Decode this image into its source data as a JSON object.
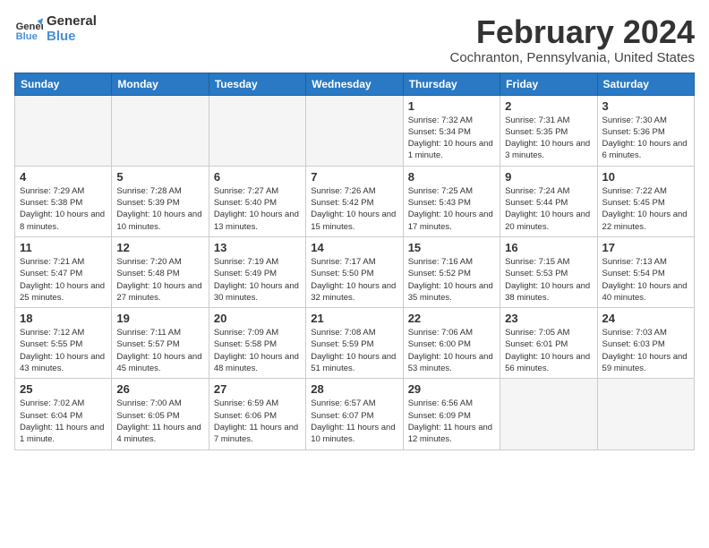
{
  "logo": {
    "text_general": "General",
    "text_blue": "Blue"
  },
  "title": "February 2024",
  "location": "Cochranton, Pennsylvania, United States",
  "weekdays": [
    "Sunday",
    "Monday",
    "Tuesday",
    "Wednesday",
    "Thursday",
    "Friday",
    "Saturday"
  ],
  "weeks": [
    [
      {
        "day": "",
        "info": "",
        "empty": true
      },
      {
        "day": "",
        "info": "",
        "empty": true
      },
      {
        "day": "",
        "info": "",
        "empty": true
      },
      {
        "day": "",
        "info": "",
        "empty": true
      },
      {
        "day": "1",
        "info": "Sunrise: 7:32 AM\nSunset: 5:34 PM\nDaylight: 10 hours and 1 minute."
      },
      {
        "day": "2",
        "info": "Sunrise: 7:31 AM\nSunset: 5:35 PM\nDaylight: 10 hours and 3 minutes."
      },
      {
        "day": "3",
        "info": "Sunrise: 7:30 AM\nSunset: 5:36 PM\nDaylight: 10 hours and 6 minutes."
      }
    ],
    [
      {
        "day": "4",
        "info": "Sunrise: 7:29 AM\nSunset: 5:38 PM\nDaylight: 10 hours and 8 minutes."
      },
      {
        "day": "5",
        "info": "Sunrise: 7:28 AM\nSunset: 5:39 PM\nDaylight: 10 hours and 10 minutes."
      },
      {
        "day": "6",
        "info": "Sunrise: 7:27 AM\nSunset: 5:40 PM\nDaylight: 10 hours and 13 minutes."
      },
      {
        "day": "7",
        "info": "Sunrise: 7:26 AM\nSunset: 5:42 PM\nDaylight: 10 hours and 15 minutes."
      },
      {
        "day": "8",
        "info": "Sunrise: 7:25 AM\nSunset: 5:43 PM\nDaylight: 10 hours and 17 minutes."
      },
      {
        "day": "9",
        "info": "Sunrise: 7:24 AM\nSunset: 5:44 PM\nDaylight: 10 hours and 20 minutes."
      },
      {
        "day": "10",
        "info": "Sunrise: 7:22 AM\nSunset: 5:45 PM\nDaylight: 10 hours and 22 minutes."
      }
    ],
    [
      {
        "day": "11",
        "info": "Sunrise: 7:21 AM\nSunset: 5:47 PM\nDaylight: 10 hours and 25 minutes."
      },
      {
        "day": "12",
        "info": "Sunrise: 7:20 AM\nSunset: 5:48 PM\nDaylight: 10 hours and 27 minutes."
      },
      {
        "day": "13",
        "info": "Sunrise: 7:19 AM\nSunset: 5:49 PM\nDaylight: 10 hours and 30 minutes."
      },
      {
        "day": "14",
        "info": "Sunrise: 7:17 AM\nSunset: 5:50 PM\nDaylight: 10 hours and 32 minutes."
      },
      {
        "day": "15",
        "info": "Sunrise: 7:16 AM\nSunset: 5:52 PM\nDaylight: 10 hours and 35 minutes."
      },
      {
        "day": "16",
        "info": "Sunrise: 7:15 AM\nSunset: 5:53 PM\nDaylight: 10 hours and 38 minutes."
      },
      {
        "day": "17",
        "info": "Sunrise: 7:13 AM\nSunset: 5:54 PM\nDaylight: 10 hours and 40 minutes."
      }
    ],
    [
      {
        "day": "18",
        "info": "Sunrise: 7:12 AM\nSunset: 5:55 PM\nDaylight: 10 hours and 43 minutes."
      },
      {
        "day": "19",
        "info": "Sunrise: 7:11 AM\nSunset: 5:57 PM\nDaylight: 10 hours and 45 minutes."
      },
      {
        "day": "20",
        "info": "Sunrise: 7:09 AM\nSunset: 5:58 PM\nDaylight: 10 hours and 48 minutes."
      },
      {
        "day": "21",
        "info": "Sunrise: 7:08 AM\nSunset: 5:59 PM\nDaylight: 10 hours and 51 minutes."
      },
      {
        "day": "22",
        "info": "Sunrise: 7:06 AM\nSunset: 6:00 PM\nDaylight: 10 hours and 53 minutes."
      },
      {
        "day": "23",
        "info": "Sunrise: 7:05 AM\nSunset: 6:01 PM\nDaylight: 10 hours and 56 minutes."
      },
      {
        "day": "24",
        "info": "Sunrise: 7:03 AM\nSunset: 6:03 PM\nDaylight: 10 hours and 59 minutes."
      }
    ],
    [
      {
        "day": "25",
        "info": "Sunrise: 7:02 AM\nSunset: 6:04 PM\nDaylight: 11 hours and 1 minute."
      },
      {
        "day": "26",
        "info": "Sunrise: 7:00 AM\nSunset: 6:05 PM\nDaylight: 11 hours and 4 minutes."
      },
      {
        "day": "27",
        "info": "Sunrise: 6:59 AM\nSunset: 6:06 PM\nDaylight: 11 hours and 7 minutes."
      },
      {
        "day": "28",
        "info": "Sunrise: 6:57 AM\nSunset: 6:07 PM\nDaylight: 11 hours and 10 minutes."
      },
      {
        "day": "29",
        "info": "Sunrise: 6:56 AM\nSunset: 6:09 PM\nDaylight: 11 hours and 12 minutes."
      },
      {
        "day": "",
        "info": "",
        "empty": true
      },
      {
        "day": "",
        "info": "",
        "empty": true
      }
    ]
  ]
}
